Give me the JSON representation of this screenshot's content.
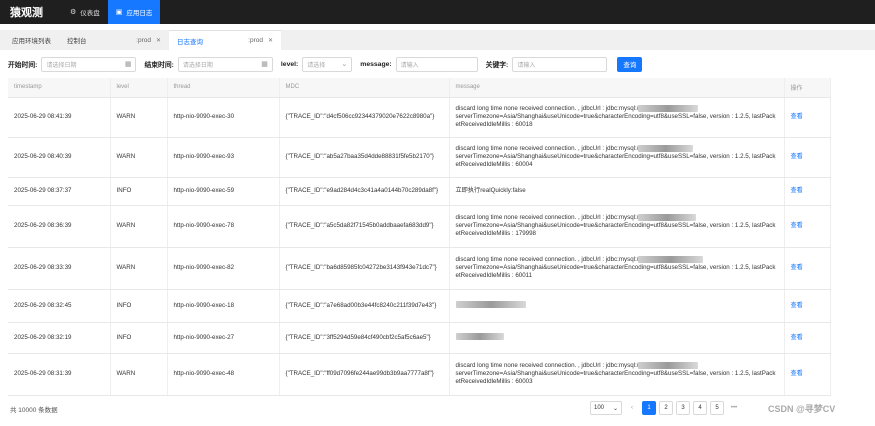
{
  "brand": "猿观测",
  "topnav": [
    {
      "label": "仪表盘",
      "icon": "⚙"
    },
    {
      "label": "应用日志",
      "icon": "▣"
    }
  ],
  "tabs": [
    {
      "label": "应用环境列表"
    },
    {
      "label": "控制台",
      "sub": "prod"
    },
    {
      "label": "日志查询",
      "sub": "prod"
    }
  ],
  "filter": {
    "start_label": "开始时间:",
    "start_placeholder": "请选择日期",
    "end_label": "结束时间:",
    "end_placeholder": "请选择日期",
    "level_label": "level:",
    "level_placeholder": "请选择",
    "message_label": "message:",
    "message_placeholder": "请输入",
    "keyword_label": "关键字:",
    "keyword_placeholder": "请输入",
    "query_button": "查询"
  },
  "table": {
    "headers": [
      "timestamp",
      "level",
      "thread",
      "MDC",
      "message",
      "操作"
    ],
    "action_label": "查看",
    "rows": [
      {
        "timestamp": "2025-06-29 08:41:39",
        "level": "WARN",
        "thread": "http-nio-9090-exec-30",
        "mdc": "{\"TRACE_ID\":\"d4cf506cc92344379020e7622c8980a\"}",
        "msg1": "discard long time none received connection. , jdbcUrl : jdbc:mysql:/",
        "msg2": "serverTimezone=Asia/Shanghai&useUnicode=true&characterEncoding=utf8&useSSL=false, version : 1.2.5, lastPacketReceivedIdleMillis : 60018"
      },
      {
        "timestamp": "2025-06-29 08:40:39",
        "level": "WARN",
        "thread": "http-nio-9090-exec-93",
        "mdc": "{\"TRACE_ID\":\"ab5a27baa35d4dde88831f5fe5b2170\"}",
        "msg1": "discard long time none received connection. , jdbcUrl : jdbc:mysql:/",
        "msg2": "serverTimezone=Asia/Shanghai&useUnicode=true&characterEncoding=utf8&useSSL=false, version : 1.2.5, lastPacketReceivedIdleMillis : 60004"
      },
      {
        "timestamp": "2025-06-29 08:37:37",
        "level": "INFO",
        "thread": "http-nio-9090-exec-59",
        "mdc": "{\"TRACE_ID\":\"e9ad284d4c3c41a4a0144b70c289da8f\"}",
        "msg1": "立即执行realQuickly:false",
        "msg2": ""
      },
      {
        "timestamp": "2025-06-29 08:36:39",
        "level": "WARN",
        "thread": "http-nio-9090-exec-78",
        "mdc": "{\"TRACE_ID\":\"a5c5da82f71545b0addbaaefa683dd9\"}",
        "msg1": "discard long time none received connection. , jdbcUrl : jdbc:mysql:/",
        "msg2": "serverTimezone=Asia/Shanghai&useUnicode=true&characterEncoding=utf8&useSSL=false, version : 1.2.5, lastPacketReceivedIdleMillis : 179998"
      },
      {
        "timestamp": "2025-06-29 08:33:39",
        "level": "WARN",
        "thread": "http-nio-9090-exec-82",
        "mdc": "{\"TRACE_ID\":\"ba6d85985fc04272be3143f943e71dc7\"}",
        "msg1": "discard long time none received connection. , jdbcUrl : jdbc:mysql:/",
        "msg2": "serverTimezone=Asia/Shanghai&useUnicode=true&characterEncoding=utf8&useSSL=false, version : 1.2.5, lastPacketReceivedIdleMillis : 60011"
      },
      {
        "timestamp": "2025-06-29 08:32:45",
        "level": "INFO",
        "thread": "http-nio-9090-exec-18",
        "mdc": "{\"TRACE_ID\":\"a7e68ad00b3e44fc8240c211f39d7e43\"}",
        "msg1": "",
        "msg2": ""
      },
      {
        "timestamp": "2025-06-29 08:32:19",
        "level": "INFO",
        "thread": "http-nio-9090-exec-27",
        "mdc": "{\"TRACE_ID\":\"3ff5294d59e84cf490cbf2c5af5c6ae5\"}",
        "msg1": "",
        "msg2": ""
      },
      {
        "timestamp": "2025-06-29 08:31:39",
        "level": "WARN",
        "thread": "http-nio-9090-exec-48",
        "mdc": "{\"TRACE_ID\":\"ff09d7096fe244ae99db3b9aa7777a8f\"}",
        "msg1": "discard long time none received connection. , jdbcUrl : jdbc:mysql:/",
        "msg2": "serverTimezone=Asia/Shanghai&useUnicode=true&characterEncoding=utf8&useSSL=false, version : 1.2.5, lastPacketReceivedIdleMillis : 60003"
      }
    ]
  },
  "footer": {
    "total": "共 10000 条数据",
    "page_size": "100",
    "pages": [
      "1",
      "2",
      "3",
      "4",
      "5"
    ],
    "ellipsis": "•••",
    "watermark": "CSDN @寻梦CV"
  }
}
